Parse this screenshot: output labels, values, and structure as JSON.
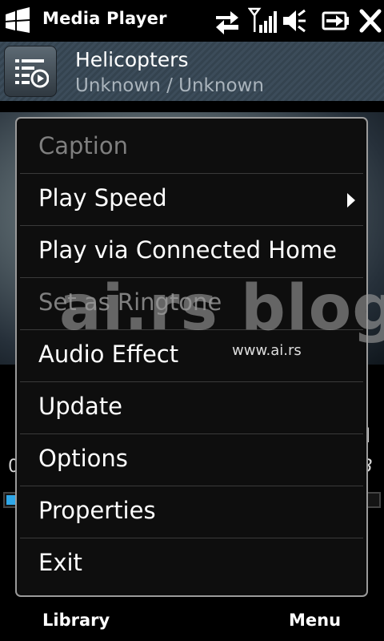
{
  "status_bar": {
    "app_title": "Media Player",
    "icons": [
      "windows-start-icon",
      "data-sync-icon",
      "signal-strength-icon",
      "volume-muted-icon",
      "battery-charging-icon",
      "close-icon"
    ]
  },
  "now_playing": {
    "title": "Helicopters",
    "artist_album": "Unknown / Unknown"
  },
  "background": {
    "title_tail": "d",
    "time_left": "0",
    "time_right": "3",
    "progress": 0.03,
    "progress_color": "#2ea7e8"
  },
  "menu": {
    "items": [
      {
        "label": "Caption",
        "enabled": false
      },
      {
        "label": "Play Speed",
        "enabled": true,
        "has_submenu": true
      },
      {
        "label": "Play via Connected Home",
        "enabled": true
      },
      {
        "label": "Set as Ringtone",
        "enabled": false
      },
      {
        "label": "Audio Effect",
        "enabled": true
      },
      {
        "label": "Update",
        "enabled": true
      },
      {
        "label": "Options",
        "enabled": true
      },
      {
        "label": "Properties",
        "enabled": true
      },
      {
        "label": "Exit",
        "enabled": true
      }
    ]
  },
  "watermark": {
    "text": "ai.rs blog",
    "url": "www.ai.rs"
  },
  "softkeys": {
    "left": "Library",
    "right": "Menu"
  }
}
